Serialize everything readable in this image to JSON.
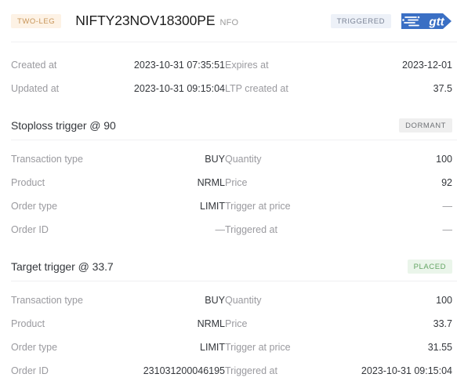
{
  "header": {
    "leg_badge": "TWO-LEG",
    "instrument": "NIFTY23NOV18300PE",
    "exchange": "NFO",
    "status_badge": "TRIGGERED",
    "logo_text": "gtt",
    "logo_name": "gtt-logo",
    "colors": {
      "two_leg_bg": "#fdf2e5",
      "two_leg_text": "#c79559",
      "triggered_bg": "#edf1f8",
      "triggered_text": "#7b8496",
      "logo_blue": "#3a6fc4"
    }
  },
  "summary": {
    "rows": [
      {
        "left_label": "Created at",
        "left_value": "2023-10-31 07:35:51",
        "right_label": "Expires at",
        "right_value": "2023-12-01"
      },
      {
        "left_label": "Updated at",
        "left_value": "2023-10-31 09:15:04",
        "right_label": "LTP created at",
        "right_value": "37.5"
      }
    ]
  },
  "sections": [
    {
      "title": "Stoploss trigger @ 90",
      "status_badge": "DORMANT",
      "badge_bg": "#efefef",
      "badge_text_color": "#6f7276",
      "rows": [
        {
          "left_label": "Transaction type",
          "left_value": "BUY",
          "right_label": "Quantity",
          "right_value": "100"
        },
        {
          "left_label": "Product",
          "left_value": "NRML",
          "right_label": "Price",
          "right_value": "92"
        },
        {
          "left_label": "Order type",
          "left_value": "LIMIT",
          "right_label": "Trigger at price",
          "right_value": "—"
        },
        {
          "left_label": "Order ID",
          "left_value": "—",
          "right_label": "Triggered at",
          "right_value": "—"
        }
      ]
    },
    {
      "title": "Target trigger @ 33.7",
      "status_badge": "PLACED",
      "badge_bg": "#eaf5ea",
      "badge_text_color": "#64a564",
      "rows": [
        {
          "left_label": "Transaction type",
          "left_value": "BUY",
          "right_label": "Quantity",
          "right_value": "100"
        },
        {
          "left_label": "Product",
          "left_value": "NRML",
          "right_label": "Price",
          "right_value": "33.7"
        },
        {
          "left_label": "Order type",
          "left_value": "LIMIT",
          "right_label": "Trigger at price",
          "right_value": "31.55"
        },
        {
          "left_label": "Order ID",
          "left_value": "231031200046195",
          "right_label": "Triggered at",
          "right_value": "2023-10-31 09:15:04"
        }
      ]
    }
  ]
}
